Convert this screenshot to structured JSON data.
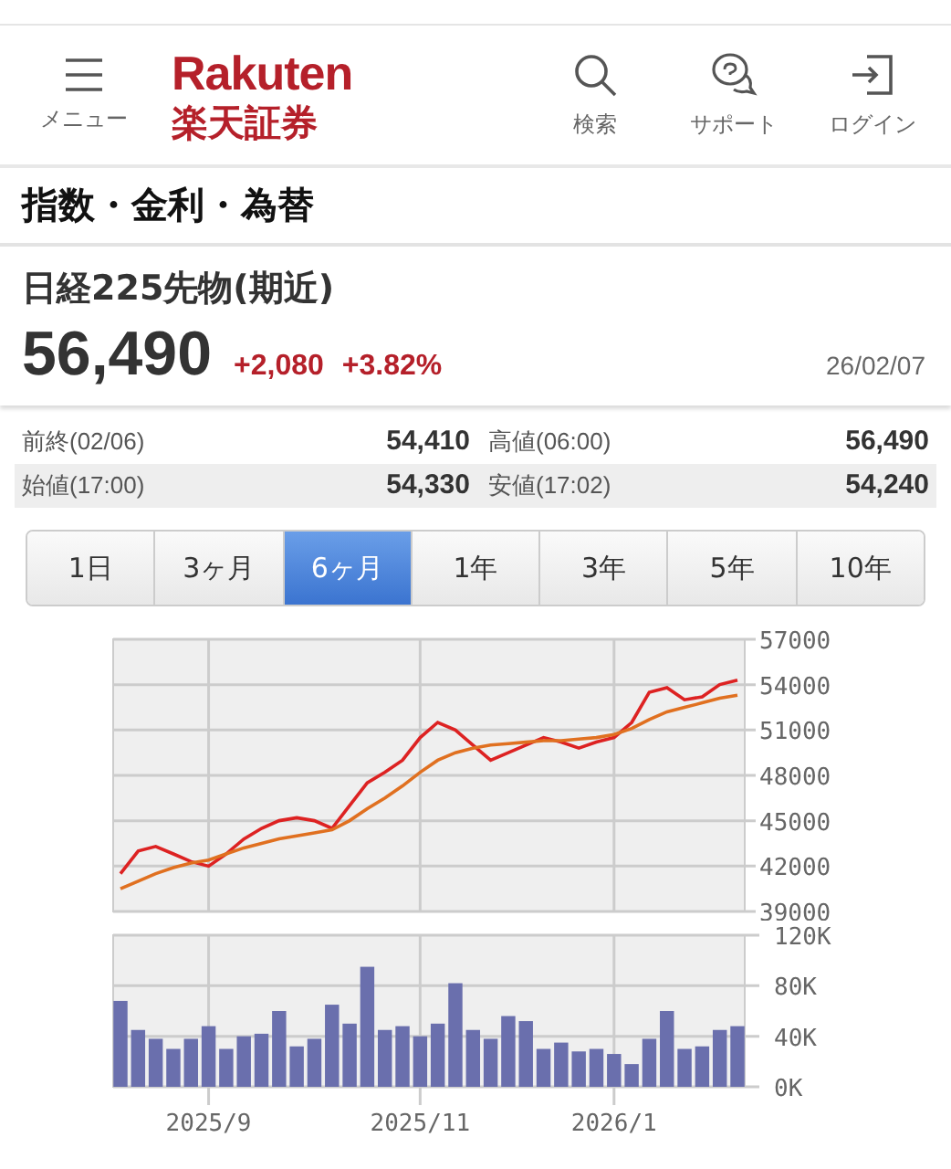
{
  "header": {
    "menu_label": "メニュー",
    "logo_word": "Rakuten",
    "logo_kanji": "楽天証券",
    "actions": [
      {
        "kind": "search",
        "label": "検索"
      },
      {
        "kind": "support",
        "label": "サポート"
      },
      {
        "kind": "login",
        "label": "ログイン"
      }
    ]
  },
  "section_title": "指数・金利・為替",
  "instrument": {
    "name": "日経225先物(期近)",
    "price": "56,490",
    "change": "+2,080",
    "change_pct": "+3.82%",
    "date": "26/02/07"
  },
  "stats": [
    {
      "label": "前終(02/06)",
      "value": "54,410",
      "label2": "高値(06:00)",
      "value2": "56,490"
    },
    {
      "label": "始値(17:00)",
      "value": "54,330",
      "label2": "安値(17:02)",
      "value2": "54,240"
    }
  ],
  "ranges": [
    {
      "label": "1日",
      "selected": false
    },
    {
      "label": "3ヶ月",
      "selected": false
    },
    {
      "label": "6ヶ月",
      "selected": true
    },
    {
      "label": "1年",
      "selected": false
    },
    {
      "label": "3年",
      "selected": false
    },
    {
      "label": "5年",
      "selected": false
    },
    {
      "label": "10年",
      "selected": false
    }
  ],
  "price_chart": {
    "chart_data": {
      "type": "line",
      "grid": true,
      "ylim": [
        39000,
        57000
      ],
      "yticks": [
        39000,
        42000,
        45000,
        48000,
        51000,
        54000,
        57000
      ],
      "series": [
        {
          "color": "#dd2222",
          "values": [
            41500,
            43000,
            43300,
            42800,
            42300,
            42000,
            42800,
            43800,
            44500,
            45000,
            45200,
            45000,
            44500,
            46000,
            47500,
            48200,
            49000,
            50500,
            51500,
            51000,
            50000,
            49000,
            49500,
            50000,
            50500,
            50200,
            49800,
            50200,
            50500,
            51500,
            53500,
            53800,
            53000,
            53200,
            54000,
            54300
          ]
        },
        {
          "color": "#e07020",
          "values": [
            40500,
            41000,
            41500,
            41900,
            42200,
            42400,
            42800,
            43200,
            43500,
            43800,
            44000,
            44200,
            44400,
            45000,
            45800,
            46500,
            47300,
            48200,
            49000,
            49500,
            49800,
            50000,
            50100,
            50200,
            50300,
            50300,
            50400,
            50500,
            50700,
            51100,
            51700,
            52200,
            52500,
            52800,
            53100,
            53300
          ]
        }
      ]
    }
  },
  "volume_chart": {
    "chart_data": {
      "type": "bar",
      "grid": true,
      "categories": [
        null,
        null,
        null,
        null,
        null,
        "2025/9",
        null,
        null,
        null,
        null,
        null,
        null,
        null,
        null,
        null,
        null,
        null,
        "2025/11",
        null,
        null,
        null,
        null,
        null,
        null,
        null,
        null,
        null,
        null,
        "2026/1",
        null,
        null,
        null,
        null,
        null,
        null,
        null
      ],
      "ylim": [
        0,
        120000
      ],
      "yticks": [
        {
          "value": 0,
          "label": "0K"
        },
        {
          "value": 40000,
          "label": "40K"
        },
        {
          "value": 80000,
          "label": "80K"
        },
        {
          "value": 120000,
          "label": "120K"
        }
      ],
      "series": [
        {
          "color": "#6a6fad",
          "values": [
            68000,
            45000,
            38000,
            30000,
            38000,
            48000,
            30000,
            40000,
            42000,
            60000,
            32000,
            38000,
            65000,
            50000,
            95000,
            45000,
            48000,
            40000,
            50000,
            82000,
            45000,
            38000,
            56000,
            52000,
            30000,
            35000,
            28000,
            30000,
            26000,
            18000,
            38000,
            60000,
            30000,
            32000,
            45000,
            48000
          ]
        }
      ]
    }
  }
}
